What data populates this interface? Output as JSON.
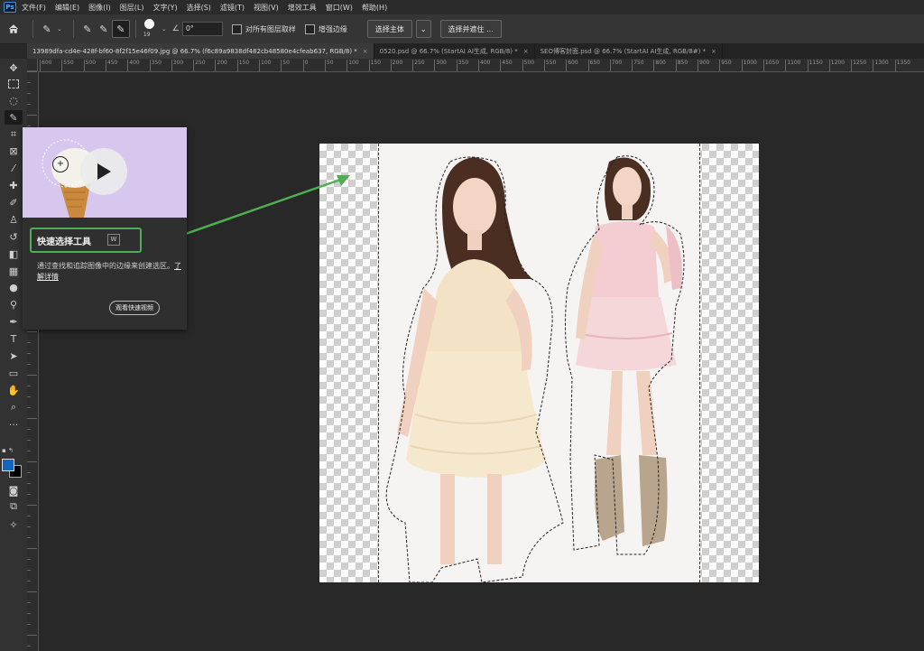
{
  "app": {
    "logo": "Ps"
  },
  "menu": [
    "文件(F)",
    "编辑(E)",
    "图像(I)",
    "图层(L)",
    "文字(Y)",
    "选择(S)",
    "滤镜(T)",
    "视图(V)",
    "增效工具",
    "窗口(W)",
    "帮助(H)"
  ],
  "options": {
    "brush_size": "19",
    "angle": "0°",
    "sample_all_layers": "对所有图层取样",
    "enhance_edge": "增强边缘",
    "select_subject": "选择主体",
    "select_and_mask": "选择并遮住 ..."
  },
  "tabs": [
    {
      "label": "13989dfa-cd4e-428f-bf60-8f2f15e46f09.jpg @ 66.7% (f6c89a9838df482cb48580e4cfeab637, RGB/8) *",
      "active": true
    },
    {
      "label": "0520.psd @ 66.7% (StartAI AI生成, RGB/8) *",
      "active": false
    },
    {
      "label": "SEO博客封面.psd @ 66.7% (StartAI AI生成, RGB/8#) *",
      "active": false
    }
  ],
  "ruler_labels": [
    "600",
    "550",
    "500",
    "450",
    "400",
    "350",
    "300",
    "250",
    "200",
    "150",
    "100",
    "50",
    "0",
    "50",
    "100",
    "150",
    "200",
    "250",
    "300",
    "350",
    "400",
    "450",
    "500",
    "550",
    "600",
    "650",
    "700",
    "750",
    "800",
    "850",
    "900",
    "950",
    "1000",
    "1050",
    "1100",
    "1150",
    "1200",
    "1250",
    "1300",
    "1350"
  ],
  "tooltip": {
    "title": "快速选择工具",
    "shortcut": "W",
    "description": "通过查找和追踪图像中的边缘来创建选区。",
    "learn_more": "了解详情",
    "watch_video": "观看快速视频"
  },
  "colors": {
    "highlight": "#4caf50",
    "foreground": "#1565c0",
    "background": "#000000"
  },
  "icons": [
    "home-icon",
    "quick-select-icon",
    "play-icon",
    "move-icon",
    "marquee-icon",
    "lasso-icon",
    "crop-icon",
    "brush-icon",
    "type-icon",
    "hand-icon",
    "zoom-icon"
  ]
}
